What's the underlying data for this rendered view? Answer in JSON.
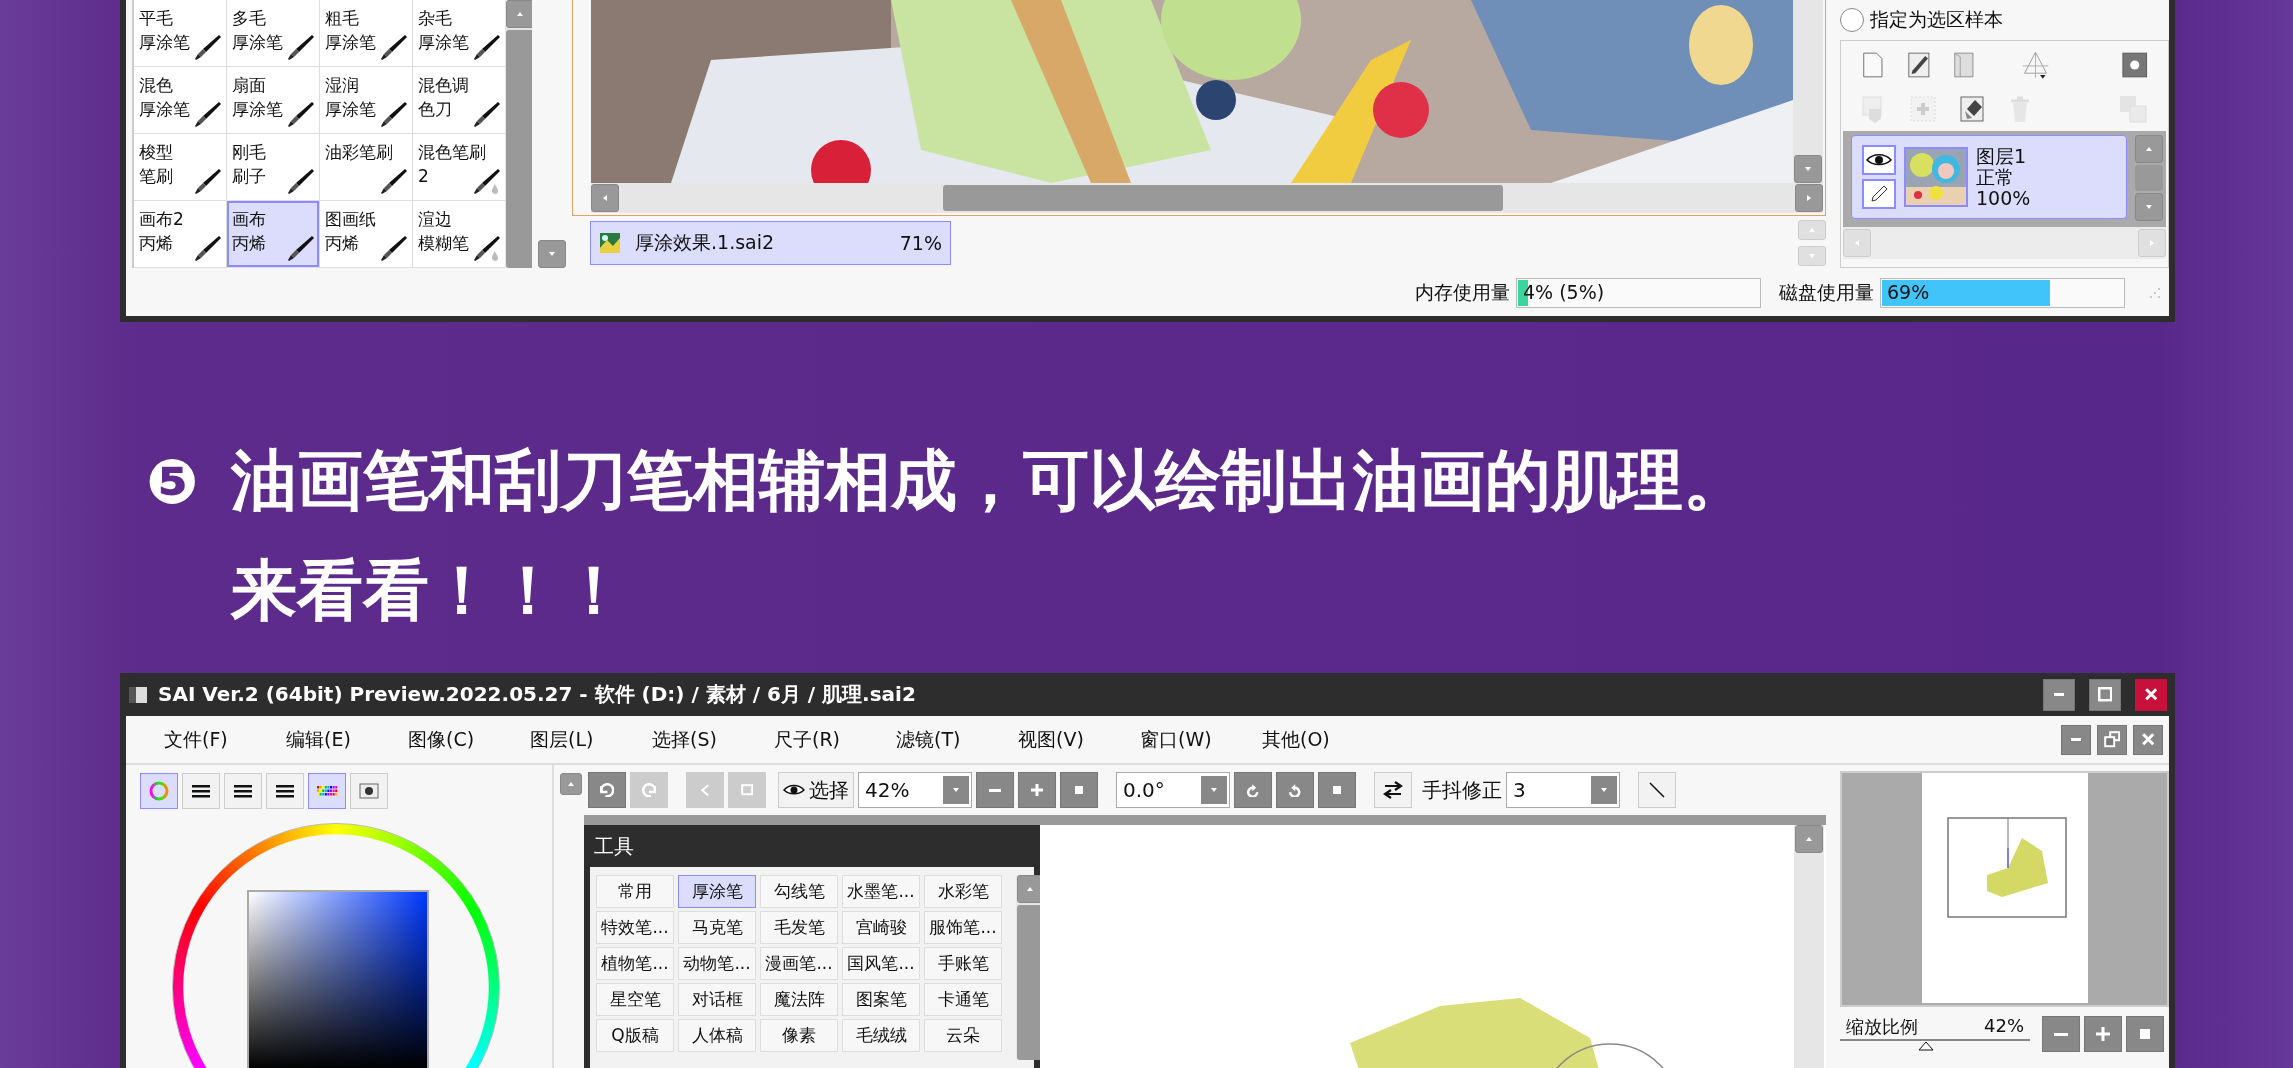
{
  "top_window": {
    "brushes": [
      {
        "lines": [
          "平毛",
          "厚涂笔"
        ],
        "selected": false,
        "blend": false
      },
      {
        "lines": [
          "多毛",
          "厚涂笔"
        ],
        "selected": false,
        "blend": false
      },
      {
        "lines": [
          "粗毛",
          "厚涂笔"
        ],
        "selected": false,
        "blend": false
      },
      {
        "lines": [
          "杂毛",
          "厚涂笔"
        ],
        "selected": false,
        "blend": false
      },
      {
        "lines": [
          "混色",
          "厚涂笔"
        ],
        "selected": false,
        "blend": false
      },
      {
        "lines": [
          "扇面",
          "厚涂笔"
        ],
        "selected": false,
        "blend": false
      },
      {
        "lines": [
          "湿润",
          "厚涂笔"
        ],
        "selected": false,
        "blend": false
      },
      {
        "lines": [
          "混色调",
          "色刀"
        ],
        "selected": false,
        "blend": false
      },
      {
        "lines": [
          "梭型",
          "笔刷"
        ],
        "selected": false,
        "blend": false
      },
      {
        "lines": [
          "刚毛",
          "刷子"
        ],
        "selected": false,
        "blend": false
      },
      {
        "lines": [
          "油彩笔刷"
        ],
        "selected": false,
        "blend": false
      },
      {
        "lines": [
          "混色笔刷",
          "2"
        ],
        "selected": false,
        "blend": true
      },
      {
        "lines": [
          "画布2",
          "丙烯"
        ],
        "selected": false,
        "blend": false
      },
      {
        "lines": [
          "画布",
          "丙烯"
        ],
        "selected": true,
        "blend": false
      },
      {
        "lines": [
          "图画纸",
          "丙烯"
        ],
        "selected": false,
        "blend": false
      },
      {
        "lines": [
          "渲边",
          "模糊笔"
        ],
        "selected": false,
        "blend": true
      }
    ],
    "document_tab": {
      "name": "厚涂效果.1.sai2",
      "zoom": "71%",
      "selected": true
    },
    "meters": [
      {
        "label": "内存使用量",
        "reading": "4% (5%)",
        "level": 0.04,
        "color": "#3ad6a0"
      },
      {
        "label": "磁盘使用量",
        "reading": "69%",
        "level": 0.69,
        "color": "#40c4fa"
      }
    ],
    "selection_sample": {
      "label": "指定为选区样本",
      "selected": false
    },
    "layers": [
      {
        "name": "图层1",
        "mode": "正常",
        "opacity": "100%",
        "visible": true,
        "selected": true
      }
    ]
  },
  "heading": {
    "marker": "❺",
    "lines": [
      "油画笔和刮刀笔相辅相成，可以绘制出油画的肌理。",
      "来看看！！！"
    ]
  },
  "bottom_window": {
    "title": "SAI Ver.2 (64bit) Preview.2022.05.27 - 软件 (D:) / 素材 / 6月 / 肌理.sai2",
    "menu": [
      "文件(F)",
      "编辑(E)",
      "图像(C)",
      "图层(L)",
      "选择(S)",
      "尺子(R)",
      "滤镜(T)",
      "视图(V)",
      "窗口(W)",
      "其他(O)"
    ],
    "color_modes": [
      {
        "kind": "wheel",
        "selected": true
      },
      {
        "kind": "bars",
        "selected": false
      },
      {
        "kind": "bars",
        "selected": false
      },
      {
        "kind": "bars",
        "selected": false
      },
      {
        "kind": "palette",
        "selected": true
      },
      {
        "kind": "swatch",
        "selected": false
      }
    ],
    "toolbar": {
      "select_label": "选择",
      "zoom": "42%",
      "angle": "0.0°",
      "stabilizer_label": "手抖修正",
      "stabilizer": "3"
    },
    "tools_title": "工具",
    "tool_sets": [
      {
        "label": "常用",
        "selected": false
      },
      {
        "label": "厚涂笔",
        "selected": true
      },
      {
        "label": "勾线笔",
        "selected": false
      },
      {
        "label": "水墨笔...",
        "selected": false
      },
      {
        "label": "水彩笔",
        "selected": false
      },
      {
        "label": "特效笔...",
        "selected": false
      },
      {
        "label": "马克笔",
        "selected": false
      },
      {
        "label": "毛发笔",
        "selected": false
      },
      {
        "label": "宫崎骏",
        "selected": false
      },
      {
        "label": "服饰笔...",
        "selected": false
      },
      {
        "label": "植物笔...",
        "selected": false
      },
      {
        "label": "动物笔...",
        "selected": false
      },
      {
        "label": "漫画笔...",
        "selected": false
      },
      {
        "label": "国风笔...",
        "selected": false
      },
      {
        "label": "手账笔",
        "selected": false
      },
      {
        "label": "星空笔",
        "selected": false
      },
      {
        "label": "对话框",
        "selected": false
      },
      {
        "label": "魔法阵",
        "selected": false
      },
      {
        "label": "图案笔",
        "selected": false
      },
      {
        "label": "卡通笔",
        "selected": false
      },
      {
        "label": "Q版稿",
        "selected": false
      },
      {
        "label": "人体稿",
        "selected": false
      },
      {
        "label": "像素",
        "selected": false
      },
      {
        "label": "毛绒绒",
        "selected": false
      },
      {
        "label": "云朵",
        "selected": false
      }
    ],
    "navigator": {
      "zoom_label": "缩放比例",
      "zoom_value": "42%",
      "level": 0.45
    }
  }
}
